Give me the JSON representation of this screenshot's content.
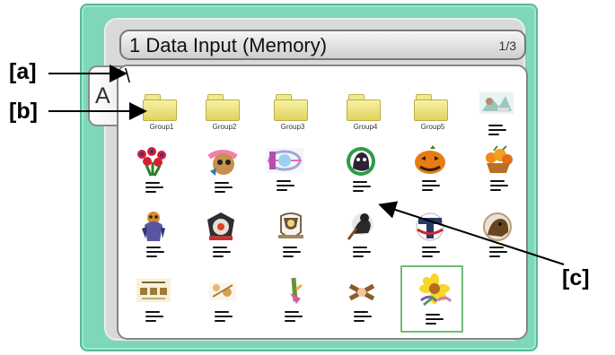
{
  "screen": {
    "title": "1 Data Input (Memory)",
    "page_indicator": "1/3",
    "current_path": "\\",
    "side_tab_label": "A"
  },
  "callouts": {
    "a": "[a]",
    "b": "[b]",
    "c": "[c]"
  },
  "folders": [
    {
      "label": "Group1"
    },
    {
      "label": "Group2"
    },
    {
      "label": "Group3"
    },
    {
      "label": "Group4"
    },
    {
      "label": "Group5"
    }
  ],
  "design_items": [
    {
      "icon": "design-thumbnail-icon"
    },
    {
      "icon": "flowers-design-icon"
    },
    {
      "icon": "bulldog-design-icon"
    },
    {
      "icon": "sports-design-icon"
    },
    {
      "icon": "gorilla-design-icon"
    },
    {
      "icon": "pumpkin-design-icon"
    },
    {
      "icon": "fruit-basket-design-icon"
    },
    {
      "icon": "creature-design-icon"
    },
    {
      "icon": "emblem-design-icon"
    },
    {
      "icon": "crest-design-icon"
    },
    {
      "icon": "baseball-player-design-icon"
    },
    {
      "icon": "baseball-logo-design-icon"
    },
    {
      "icon": "animal-design-icon"
    },
    {
      "icon": "club-design-icon"
    },
    {
      "icon": "small-design-icon"
    },
    {
      "icon": "tool-design-icon"
    },
    {
      "icon": "pattern-design-icon"
    },
    {
      "icon": "sunflower-design-icon"
    }
  ],
  "colors": {
    "frame_green": "#7ed8b8",
    "selection_green": "#6fbb75",
    "folder_yellow": "#f0ea88"
  }
}
